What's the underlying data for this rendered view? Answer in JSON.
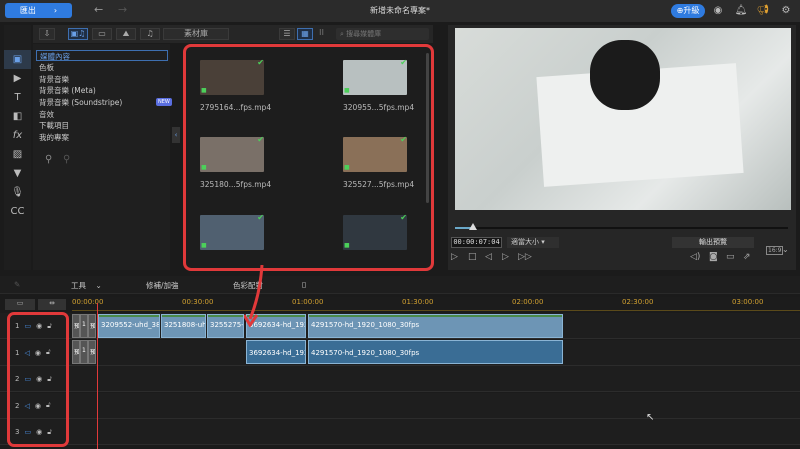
{
  "topbar": {
    "export_label": "匯出",
    "title": "新增未命名專案*",
    "upgrade_label": "升級"
  },
  "media_toolbar": {
    "library_label": "素材庫",
    "search_placeholder": "搜尋媒體庫"
  },
  "categories": [
    {
      "label": "媒體內容",
      "selected": true
    },
    {
      "label": "色板"
    },
    {
      "label": "背景音樂"
    },
    {
      "label": "背景音樂 (Meta)"
    },
    {
      "label": "背景音樂 (Soundstripe)",
      "badge": "NEW"
    },
    {
      "label": "音效"
    },
    {
      "label": "下載項目"
    },
    {
      "label": "我的專案"
    }
  ],
  "media_items": [
    {
      "name": "2795164...fps.mp4",
      "color": "#4a4038"
    },
    {
      "name": "320955...5fps.mp4",
      "color": "#b8c0c0"
    },
    {
      "name": "325180...5fps.mp4",
      "color": "#7a7068"
    },
    {
      "name": "325527...5fps.mp4",
      "color": "#8a7058"
    },
    {
      "name": "",
      "color": "#506070"
    },
    {
      "name": "",
      "color": "#303840"
    }
  ],
  "preview": {
    "timecode": "00:00:07:04",
    "fit_label": "適當大小",
    "output_preview_label": "輸出預覽",
    "ratio": "16:9",
    "progress_percent": 5
  },
  "timeline_toolbar": {
    "tools_label": "工具",
    "fix_label": "修補/加強",
    "color_label": "色彩配對"
  },
  "ruler": [
    "00:00:00",
    "00:30:00",
    "01:00:00",
    "01:30:00",
    "02:00:00",
    "02:30:00",
    "03:00:00"
  ],
  "tracks": [
    {
      "num": "1",
      "type": "video"
    },
    {
      "num": "1",
      "type": "audio"
    },
    {
      "num": "2",
      "type": "video"
    },
    {
      "num": "2",
      "type": "audio"
    },
    {
      "num": "3",
      "type": "video"
    }
  ],
  "clips_video": [
    "3209552-uhd_38",
    "3251808-uh",
    "3255275-",
    "3692634-hd_192",
    "4291570-hd_1920_1080_30fps"
  ],
  "clips_audio": [
    "3692634-hd_192",
    "4291570-hd_1920_1080_30fps"
  ],
  "small_clips": [
    "預",
    "1",
    "預"
  ]
}
